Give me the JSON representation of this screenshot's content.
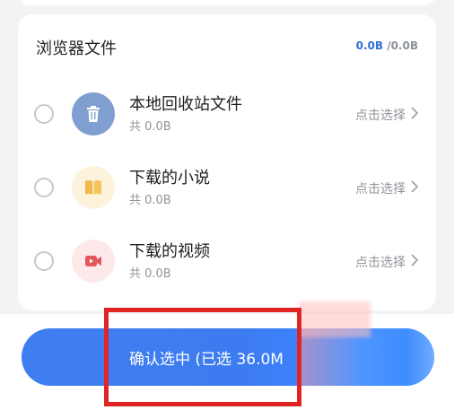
{
  "section": {
    "title": "浏览器文件",
    "size_selected": "0.0B",
    "size_total": "/0.0B"
  },
  "items": [
    {
      "title": "本地回收站文件",
      "size": "共 0.0B",
      "action": "点击选择",
      "icon": "trash-icon",
      "icon_bg": "#7f9fd0"
    },
    {
      "title": "下载的小说",
      "size": "共 0.0B",
      "action": "点击选择",
      "icon": "book-icon",
      "icon_bg": "#fdf3dc"
    },
    {
      "title": "下载的视频",
      "size": "共 0.0B",
      "action": "点击选择",
      "icon": "video-icon",
      "icon_bg": "#fde9ea"
    }
  ],
  "confirm": {
    "label": "确认选中 (已选 36.0M"
  },
  "colors": {
    "accent": "#3f7ef1",
    "highlight": "#e02424"
  }
}
